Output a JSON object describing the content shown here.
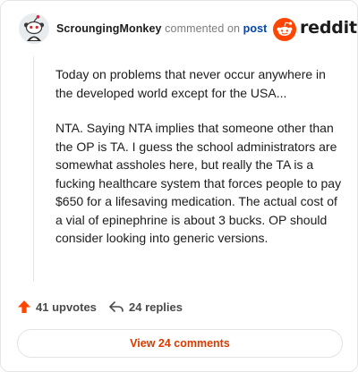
{
  "header": {
    "username": "ScroungingMonkey",
    "verb": "commented on",
    "post_link": "post",
    "brand": "reddit"
  },
  "comment": {
    "paragraphs": [
      "Today on problems that never occur anywhere in the developed world except for the USA...",
      "NTA. Saying NTA implies that someone other than the OP is TA. I guess the school administrators are somewhat assholes here, but really the TA is a fucking healthcare system that forces people to pay $650 for a lifesaving medication. The actual cost of a vial of epinephrine is about 3 bucks. OP should consider looking into generic versions."
    ]
  },
  "actions": {
    "upvotes": "41 upvotes",
    "replies": "24 replies"
  },
  "footer": {
    "view_comments": "View 24 comments"
  },
  "colors": {
    "brand_orange": "#ff4500",
    "upvote": "#ff4500",
    "post_link": "#0045ac",
    "view_button_text": "#d93a00"
  }
}
